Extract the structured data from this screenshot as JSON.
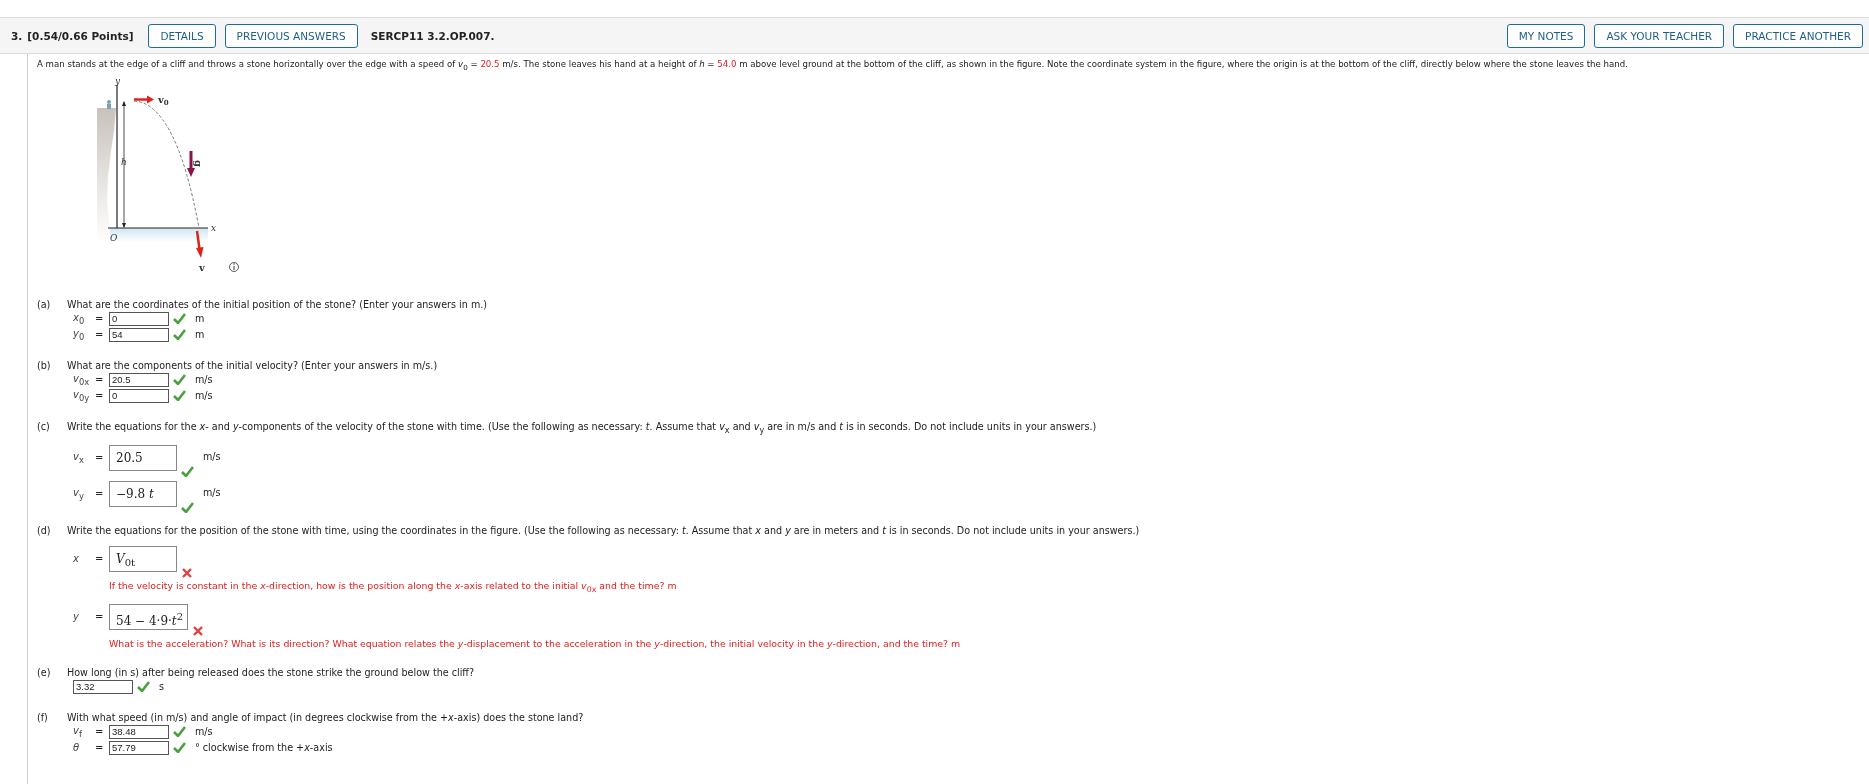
{
  "header": {
    "number": "3.",
    "points": "[0.54/0.66 Points]",
    "left_buttons": [
      "DETAILS",
      "PREVIOUS ANSWERS"
    ],
    "code": "SERCP11 3.2.OP.007.",
    "right_buttons": [
      "MY NOTES",
      "ASK YOUR TEACHER",
      "PRACTICE ANOTHER"
    ]
  },
  "problem": [
    {
      "kind": "text",
      "text": "A man stands at the edge of a cliff and throws a stone horizontally over the edge with a speed of "
    },
    {
      "kind": "text",
      "text": "*v*$_{0}$ = "
    },
    {
      "kind": "value",
      "text": "20.5"
    },
    {
      "kind": "text",
      "text": " m/s. The stone leaves his hand at a height of *h* = "
    },
    {
      "kind": "value",
      "text": "54.0"
    },
    {
      "kind": "text",
      "text": " m above level ground at the bottom of the cliff, as shown in the figure. Note the coordinate system in the figure, where the origin is at the bottom of the cliff, directly below where the stone leaves the hand."
    }
  ],
  "figure": {
    "axis_y": "y",
    "axis_x": "x",
    "origin": "O",
    "height": "h",
    "v0": "v",
    "v0_sub": "0",
    "g": "g",
    "v": "v"
  },
  "parts": [
    {
      "label": "(a)",
      "question": "What are the coordinates of the initial position of the stone? (Enter your answers in m.)",
      "answers": [
        {
          "kind": "simple",
          "var": "*x*$_{0}$",
          "eq": "=",
          "value": "0",
          "correct": true,
          "unit": "m"
        },
        {
          "kind": "simple",
          "var": "*y*$_{0}$",
          "eq": "=",
          "value": "54",
          "correct": true,
          "unit": "m"
        }
      ]
    },
    {
      "label": "(b)",
      "question": "What are the components of the initial velocity? (Enter your answers in m/s.)",
      "answers": [
        {
          "kind": "simple",
          "var": "*v*$_{0x}$",
          "eq": "=",
          "value": "20.5",
          "correct": true,
          "unit": "m/s"
        },
        {
          "kind": "simple",
          "var": "*v*$_{0y}$",
          "eq": "=",
          "value": "0",
          "correct": true,
          "unit": "m/s"
        }
      ]
    },
    {
      "label": "(c)",
      "question": "Write the equations for the *x*- and *y*-components of the velocity of the stone with time. (Use the following as necessary: *t*. Assume that *v*$_{x}$ and *v*$_{y}$ are in m/s and *t* is in seconds. Do not include units in your answers.)",
      "answers": [
        {
          "kind": "math",
          "var": "*v*$_{x}$",
          "eq": "=",
          "value": "20.5",
          "correct": true,
          "unit": "m/s"
        },
        {
          "kind": "math",
          "var": "*v*$_{y}$",
          "eq": "=",
          "value": "−9.8 *t*",
          "correct": true,
          "unit": "m/s"
        }
      ]
    },
    {
      "label": "(d)",
      "question": "Write the equations for the position of the stone with time, using the coordinates in the figure. (Use the following as necessary: *t*. Assume that *x* and *y* are in meters and *t* is in seconds. Do not include units in your answers.)",
      "answers": [
        {
          "kind": "math",
          "var": "*x*",
          "eq": "=",
          "value": "*V*$_{0t}$",
          "correct": false,
          "hint": "If the velocity is constant in the *x*-direction, how is the position along the *x*-axis related to the initial *v*$_{0x}$ and the time? m"
        },
        {
          "kind": "math",
          "var": "*y*",
          "eq": "=",
          "value": "54 − 4·9·*t*$^{2}$",
          "correct": false,
          "hint": "What is the acceleration? What is its direction? What equation relates the *y*-displacement to the acceleration in the *y*-direction, the initial velocity in the *y*-direction, and the time? m"
        }
      ]
    },
    {
      "label": "(e)",
      "question": "How long (in s) after being released does the stone strike the ground below the cliff?",
      "answers": [
        {
          "kind": "plain",
          "value": "3.32",
          "correct": true,
          "unit": "s"
        }
      ]
    },
    {
      "label": "(f)",
      "question": "With what speed (in m/s) and angle of impact (in degrees clockwise from the +*x*-axis) does the stone land?",
      "answers": [
        {
          "kind": "simple",
          "var": "*v*$_{f}$",
          "eq": "=",
          "value": "38.48",
          "correct": true,
          "unit": "m/s"
        },
        {
          "kind": "simple",
          "var": "*θ*",
          "eq": "=",
          "value": "57.79",
          "correct": true,
          "unit": "° clockwise from the +*x*-axis"
        }
      ]
    }
  ]
}
